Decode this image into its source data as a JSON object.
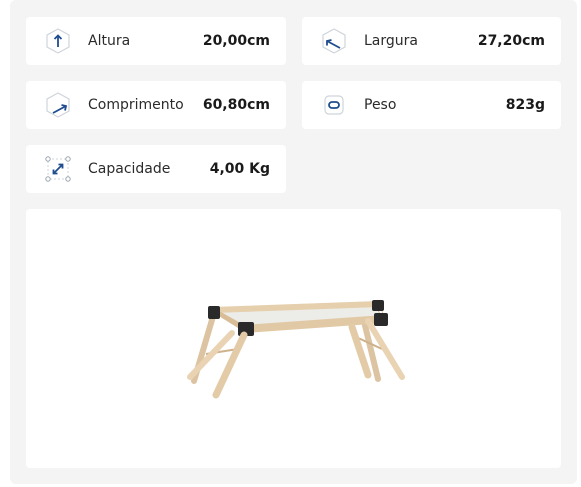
{
  "specs": {
    "altura": {
      "label": "Altura",
      "value": "20,00cm",
      "icon": "height-icon"
    },
    "largura": {
      "label": "Largura",
      "value": "27,20cm",
      "icon": "width-icon"
    },
    "comprimento": {
      "label": "Comprimento",
      "value": "60,80cm",
      "icon": "length-icon"
    },
    "peso": {
      "label": "Peso",
      "value": "823g",
      "icon": "weight-icon"
    },
    "capacidade": {
      "label": "Capacidade",
      "value": "4,00 Kg",
      "icon": "capacity-icon"
    }
  },
  "colors": {
    "panel_bg": "#f4f4f4",
    "card_bg": "#ffffff",
    "icon_accent": "#1f4d8f",
    "wood": "#e8d2b4",
    "corner": "#2a2a2a"
  }
}
